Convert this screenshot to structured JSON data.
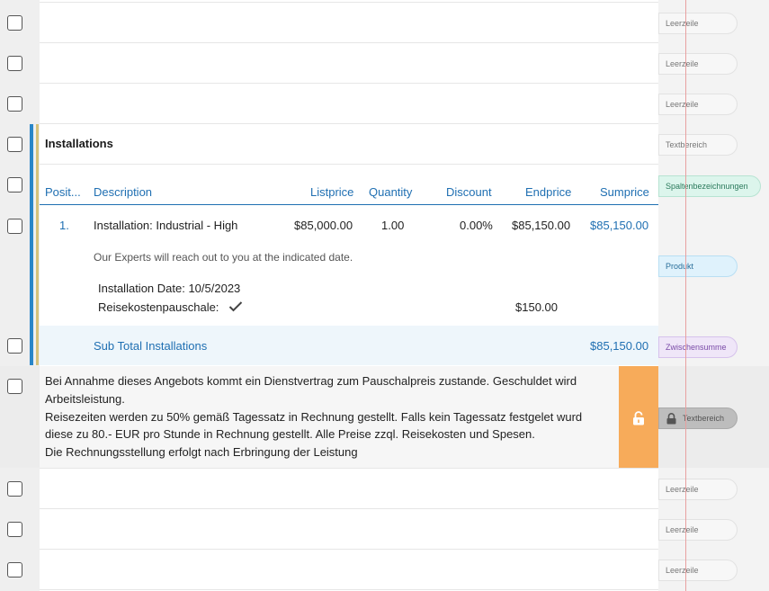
{
  "side_labels": {
    "leerzeile": "Leerzeile",
    "textbereich": "Textbereich",
    "spaltenbezeichnungen": "Spaltenbezeichnungen",
    "produkt": "Produkt",
    "zwischensumme": "Zwischensumme"
  },
  "section": {
    "title": "Installations"
  },
  "columns": {
    "position": "Posit...",
    "description": "Description",
    "listprice": "Listprice",
    "quantity": "Quantity",
    "discount": "Discount",
    "endprice": "Endprice",
    "sumprice": "Sumprice"
  },
  "product": {
    "position": "1.",
    "description": "Installation: Industrial - High",
    "listprice": "$85,000.00",
    "quantity": "1.00",
    "discount": "0.00%",
    "endprice": "$85,150.00",
    "sumprice": "$85,150.00",
    "note": "Our Experts will reach out to you at the indicated date.",
    "installation_date": "Installation Date: 10/5/2023",
    "travel_label": "Reisekostenpauschale:",
    "travel_price": "$150.00"
  },
  "subtotal": {
    "label": "Sub Total Installations",
    "value": "$85,150.00"
  },
  "text_block": {
    "lines": [
      "Bei Annahme dieses Angebots kommt ein Dienstvertrag zum Pauschalpreis zustande. Geschuldet wird",
      "Arbeitsleistung.",
      "Reisezeiten werden zu 50% gemäß Tagessatz in Rechnung gestellt. Falls kein Tagessatz festgelet wurd",
      "diese zu 80.- EUR pro Stunde in Rechnung gestellt. Alle Preise zzql. Reisekosten und Spesen.",
      "Die Rechnungsstellung erfolgt nach Erbringung der Leistung"
    ]
  },
  "colors": {
    "accent_blue": "#1f6fb2",
    "lock_orange": "#f7ab5a",
    "bar_blue": "#2a86c8",
    "bar_gold": "#d6c27a"
  }
}
